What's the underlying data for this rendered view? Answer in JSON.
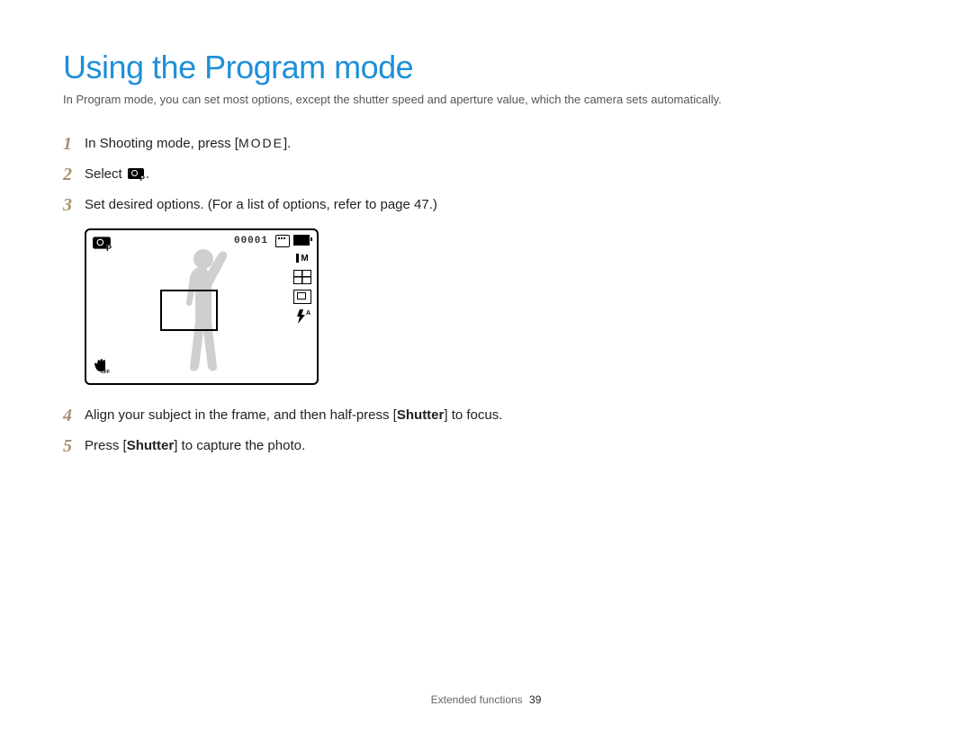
{
  "title": "Using the Program mode",
  "intro": "In Program mode, you can set most options, except the shutter speed and aperture value, which the camera sets automatically.",
  "steps": {
    "s1": {
      "num": "1",
      "pre": "In Shooting mode, press [",
      "mode": "MODE",
      "post": "]."
    },
    "s2": {
      "num": "2",
      "pre": "Select ",
      "icon_name": "program-mode-icon",
      "post": "."
    },
    "s3": {
      "num": "3",
      "text": "Set desired options. (For a list of options, refer to page 47.)"
    },
    "s4": {
      "num": "4",
      "pre": "Align your subject in the frame, and then half-press [",
      "bold": "Shutter",
      "post": "] to focus."
    },
    "s5": {
      "num": "5",
      "pre": "Press [",
      "bold": "Shutter",
      "post": "] to capture the photo."
    }
  },
  "display": {
    "counter": "00001",
    "size_label": "M",
    "flash_label": "A"
  },
  "footer": {
    "section": "Extended functions",
    "page": "39"
  }
}
